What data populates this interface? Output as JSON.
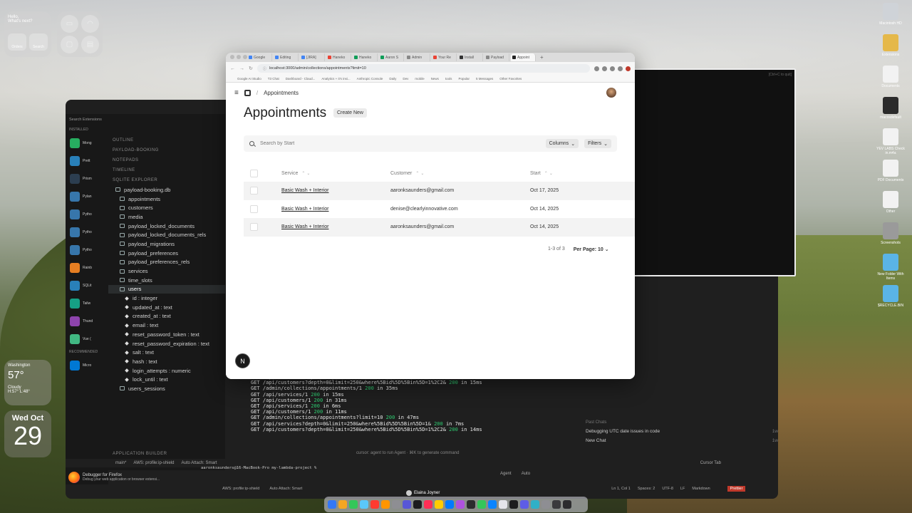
{
  "desktop": {
    "hello_widget": {
      "title": "Hello,",
      "subtitle": "What's next?",
      "btn1": "Orders",
      "btn2": "Search"
    },
    "weather": {
      "city": "Washington",
      "temp": "57°",
      "condition": "Cloudy",
      "range": "H:57° L:48°"
    },
    "date": {
      "day": "Wed Oct",
      "num": "29"
    },
    "icons": [
      {
        "label": "Macintosh HD"
      },
      {
        "label": "Extensions"
      },
      {
        "label": "Documents"
      },
      {
        "label": "macosdefault"
      },
      {
        "label": "YEV LABS Check in.m4a"
      },
      {
        "label": "PDF Documents"
      },
      {
        "label": "Other"
      },
      {
        "label": "Screenshots"
      },
      {
        "label": "New Folder With Items"
      },
      {
        "label": "$RECYCLE.BIN"
      }
    ]
  },
  "vscode": {
    "sections": {
      "outline": "OUTLINE",
      "payload_booking": "PAYLOAD-BOOKING",
      "notepads": "NOTEPADS",
      "timeline": "TIMELINE",
      "sqlite": "SQLITE EXPLORER",
      "app_builder": "APPLICATION BUILDER"
    },
    "db_name": "payload-booking.db",
    "tables": [
      "appointments",
      "customers",
      "media",
      "payload_locked_documents",
      "payload_locked_documents_rels",
      "payload_migrations",
      "payload_preferences",
      "payload_preferences_rels",
      "services",
      "time_slots"
    ],
    "users_table": "users",
    "users_columns": [
      "id : integer",
      "updated_at : text",
      "created_at : text",
      "email : text",
      "reset_password_token : text",
      "reset_password_expiration : text",
      "salt : text",
      "hash : text",
      "login_attempts : numeric",
      "lock_until : text"
    ],
    "users_sessions": "users_sessions",
    "ext_search": "Search Extensions",
    "ext_installed": "INSTALLED",
    "ext_recommended": "RECOMMENDED",
    "extensions": [
      "Mong",
      "Prett",
      "Prism",
      "Pylan",
      "Pytho",
      "Pytho",
      "Pytho",
      "Rainb",
      "SQLit",
      "Tailw",
      "Thund",
      "Vue (",
      "Micro"
    ],
    "terminal_lines": [
      {
        "text": "GET /api/services?depth=0&limit=250&where%5Bid%5D%5Bin%5D=1&",
        "code": "200",
        "time": "in 7ms"
      },
      {
        "text": "GET /api/customers?depth=0&limit=250&where%5Bid%5D%5Bin%5D=1%2C2&",
        "code": "200",
        "time": "in 15ms"
      },
      {
        "text": "GET /admin/collections/appointments/1",
        "code": "200",
        "time": "in 35ms"
      },
      {
        "text": "GET /api/services/1",
        "code": "200",
        "time": "in 15ms"
      },
      {
        "text": "GET /api/customers/1",
        "code": "200",
        "time": "in 31ms"
      },
      {
        "text": "GET /api/services/1",
        "code": "200",
        "time": "in 6ms"
      },
      {
        "text": "GET /api/customers/1",
        "code": "200",
        "time": "in 11ms"
      },
      {
        "text": "GET /admin/collections/appointments?limit=10",
        "code": "200",
        "time": "in 47ms"
      },
      {
        "text": "GET /api/services?depth=0&limit=250&where%5Bid%5D%5Bin%5D=1&",
        "code": "200",
        "time": "in 7ms"
      },
      {
        "text": "GET /api/customers?depth=0&limit=250&where%5Bid%5D%5Bin%5D=1%2C2&",
        "code": "200",
        "time": "in 14ms"
      }
    ],
    "agent_hint": "cursor: agent to run Agent · ⌘K to generate command",
    "status_left": "main*",
    "status_aws": "AWS: profile:ip-shield",
    "status_attach": "Auto Attach: Smart",
    "cursor_tab": "Cursor Tab",
    "status2": [
      "Ln 1, Col 1",
      "Spaces: 2",
      "UTF-8",
      "LF",
      "Markdown"
    ],
    "prettier": "Prettier",
    "chat_header": "Past Chats",
    "chats": [
      {
        "title": "Debugging UTC date issues in code",
        "age": "1w"
      },
      {
        "title": "New Chat",
        "age": "1w"
      }
    ],
    "prompt_line": "aaronksaunders@16-MacBook-Pro my-lambda-project % ",
    "agent_label": "Agent",
    "auto_label": "Auto",
    "firefox": {
      "title": "Debugger for Firefox",
      "desc": "Debug your web application or browser extensi..."
    },
    "term2_hint": "[Ctrl+C to quit]"
  },
  "browser": {
    "tabs": [
      "Google",
      "Editing",
      "[JIRA]",
      "Haneko",
      "Haneko",
      "Aaron S",
      "Admin",
      "Your Re",
      "Install",
      "Payload",
      "Appoint"
    ],
    "url": "localhost:3000/admin/collections/appointments?limit=10",
    "bookmarks": [
      "Google AI Studio",
      "T3 Chat",
      "Dashboard - Claud...",
      "Analytics + it's insi...",
      "Anthropic Console",
      "Daily",
      "Dev",
      "mobile",
      "News",
      "tools",
      "Popular",
      "5 Messages",
      "Other Favorites"
    ]
  },
  "app": {
    "breadcrumb": "Appointments",
    "title": "Appointments",
    "create_new": "Create New",
    "search_placeholder": "Search by Start",
    "columns_btn": "Columns",
    "filters_btn": "Filters",
    "headers": {
      "service": "Service",
      "customer": "Customer",
      "start": "Start"
    },
    "rows": [
      {
        "service": "Basic Wash + Interior",
        "customer": "aaronksaunders@gmail.com",
        "start": "Oct 17, 2025"
      },
      {
        "service": "Basic Wash + Interior",
        "customer": "denise@clearlyinnovative.com",
        "start": "Oct 14, 2025"
      },
      {
        "service": "Basic Wash + Interior",
        "customer": "aaronksaunders@gmail.com",
        "start": "Oct 14, 2025"
      }
    ],
    "pagination": {
      "range": "1-3 of 3",
      "per_page": "Per Page: 10"
    },
    "next_badge": "N"
  },
  "dock_user": "Elaina Joyner"
}
